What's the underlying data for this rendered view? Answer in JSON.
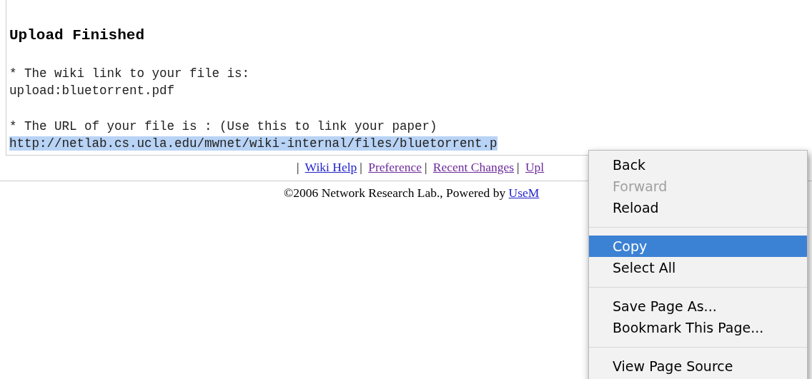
{
  "content": {
    "heading": "Upload Finished",
    "lines": [
      {
        "kind": "text",
        "text": "* The wiki link to your file is:"
      },
      {
        "kind": "text",
        "text": "upload:bluetorrent.pdf"
      },
      {
        "kind": "blank"
      },
      {
        "kind": "text",
        "text": "* The URL of your file is : (Use this to link your paper)"
      },
      {
        "kind": "selected",
        "text": "http://netlab.cs.ucla.edu/mwnet/wiki-internal/files/bluetorrent.p"
      }
    ]
  },
  "nav_links": [
    {
      "label": "Wiki Help",
      "visited": false
    },
    {
      "label": "Preference",
      "visited": true
    },
    {
      "label": "Recent Changes",
      "visited": true
    },
    {
      "label": "Upl",
      "visited": true
    }
  ],
  "nav_separator": "|",
  "footer": {
    "text": "©2006 Network Research Lab., Powered by ",
    "link": "UseM"
  },
  "context_menu": [
    {
      "kind": "item",
      "label": "Back",
      "disabled": false,
      "selected": false
    },
    {
      "kind": "item",
      "label": "Forward",
      "disabled": true,
      "selected": false
    },
    {
      "kind": "item",
      "label": "Reload",
      "disabled": false,
      "selected": false
    },
    {
      "kind": "separator"
    },
    {
      "kind": "item",
      "label": "Copy",
      "disabled": false,
      "selected": true
    },
    {
      "kind": "item",
      "label": "Select All",
      "disabled": false,
      "selected": false
    },
    {
      "kind": "separator"
    },
    {
      "kind": "item",
      "label": "Save Page As...",
      "disabled": false,
      "selected": false
    },
    {
      "kind": "item",
      "label": "Bookmark This Page...",
      "disabled": false,
      "selected": false
    },
    {
      "kind": "separator"
    },
    {
      "kind": "item",
      "label": "View Page Source",
      "disabled": false,
      "selected": false
    }
  ]
}
